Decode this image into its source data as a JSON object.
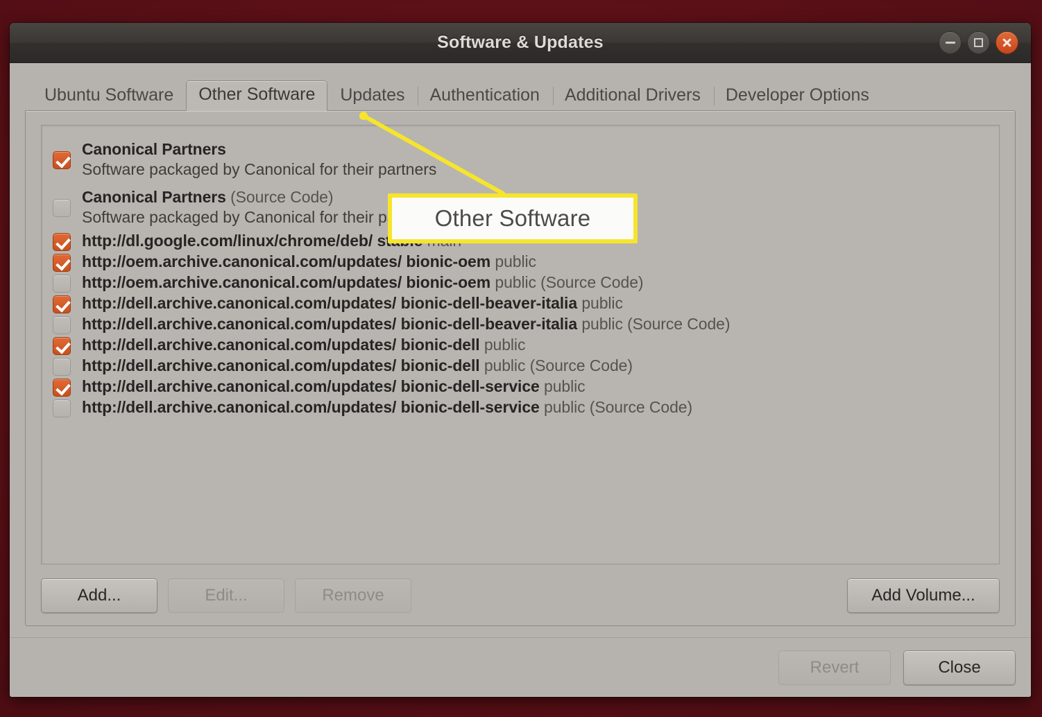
{
  "window": {
    "title": "Software & Updates",
    "controls": [
      {
        "name": "minimize",
        "icon": "minimize-icon"
      },
      {
        "name": "maximize",
        "icon": "maximize-icon"
      },
      {
        "name": "close",
        "icon": "close-icon"
      }
    ],
    "close_color": "#d4541f"
  },
  "tabs": [
    {
      "label": "Ubuntu Software",
      "active": false
    },
    {
      "label": "Other Software",
      "active": true
    },
    {
      "label": "Updates",
      "active": false
    },
    {
      "label": "Authentication",
      "active": false
    },
    {
      "label": "Additional Drivers",
      "active": false
    },
    {
      "label": "Developer Options",
      "active": false
    }
  ],
  "sources": [
    {
      "checked": true,
      "title": "Canonical Partners",
      "title_light": "",
      "description": "Software packaged by Canonical for their partners"
    },
    {
      "checked": false,
      "title": "Canonical Partners",
      "title_light": "(Source Code)",
      "description": "Software packaged by Canonical for their partners"
    },
    {
      "checked": true,
      "title": "http://dl.google.com/linux/chrome/deb/ stable",
      "title_light": "main",
      "description": ""
    },
    {
      "checked": true,
      "title": "http://oem.archive.canonical.com/updates/ bionic-oem",
      "title_light": "public",
      "description": ""
    },
    {
      "checked": false,
      "title": "http://oem.archive.canonical.com/updates/ bionic-oem",
      "title_light": "public (Source Code)",
      "description": ""
    },
    {
      "checked": true,
      "title": "http://dell.archive.canonical.com/updates/ bionic-dell-beaver-italia",
      "title_light": "public",
      "description": ""
    },
    {
      "checked": false,
      "title": "http://dell.archive.canonical.com/updates/ bionic-dell-beaver-italia",
      "title_light": "public (Source Code)",
      "description": ""
    },
    {
      "checked": true,
      "title": "http://dell.archive.canonical.com/updates/ bionic-dell",
      "title_light": "public",
      "description": ""
    },
    {
      "checked": false,
      "title": "http://dell.archive.canonical.com/updates/ bionic-dell",
      "title_light": "public (Source Code)",
      "description": ""
    },
    {
      "checked": true,
      "title": "http://dell.archive.canonical.com/updates/ bionic-dell-service",
      "title_light": "public",
      "description": ""
    },
    {
      "checked": false,
      "title": "http://dell.archive.canonical.com/updates/ bionic-dell-service",
      "title_light": "public (Source Code)",
      "description": ""
    }
  ],
  "list_actions": {
    "add_label": "Add...",
    "add_enabled": true,
    "edit_label": "Edit...",
    "edit_enabled": false,
    "remove_label": "Remove",
    "remove_enabled": false,
    "add_volume_label": "Add Volume...",
    "add_volume_enabled": true
  },
  "footer": {
    "revert_label": "Revert",
    "revert_enabled": false,
    "close_label": "Close",
    "close_enabled": true
  },
  "annotation": {
    "label": "Other Software",
    "accent_color": "#f7e52b",
    "box_background": "#fbfbf9",
    "points_to": "tab-other-software"
  }
}
